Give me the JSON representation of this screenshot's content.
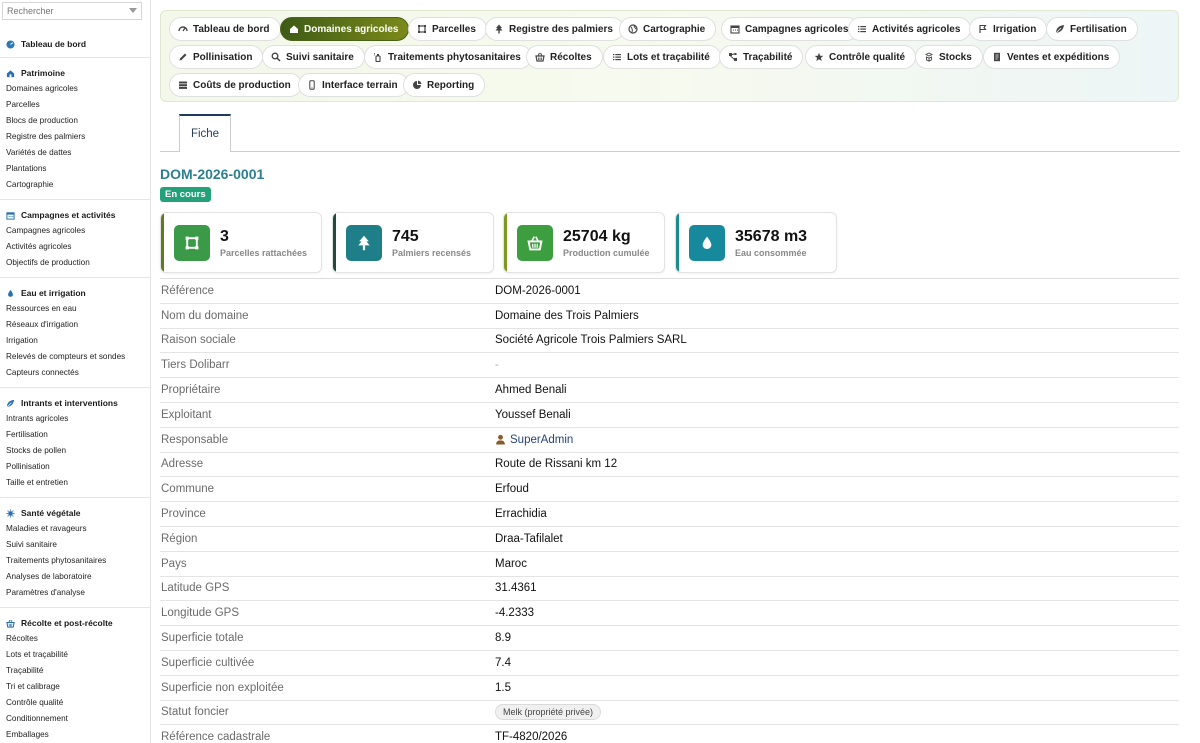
{
  "sidebar": {
    "search_placeholder": "Rechercher",
    "dashboard": "Tableau de bord",
    "sections": [
      {
        "title": "Patrimoine",
        "items": [
          "Domaines agricoles",
          "Parcelles",
          "Blocs de production",
          "Registre des palmiers",
          "Variétés de dattes",
          "Plantations",
          "Cartographie"
        ]
      },
      {
        "title": "Campagnes et activités",
        "items": [
          "Campagnes agricoles",
          "Activités agricoles",
          "Objectifs de production"
        ]
      },
      {
        "title": "Eau et irrigation",
        "items": [
          "Ressources en eau",
          "Réseaux d'irrigation",
          "Irrigation",
          "Relevés de compteurs et sondes",
          "Capteurs connectés"
        ]
      },
      {
        "title": "Intrants et interventions",
        "items": [
          "Intrants agricoles",
          "Fertilisation",
          "Stocks de pollen",
          "Pollinisation",
          "Taille et entretien"
        ]
      },
      {
        "title": "Santé végétale",
        "items": [
          "Maladies et ravageurs",
          "Suivi sanitaire",
          "Traitements phytosanitaires",
          "Analyses de laboratoire",
          "Paramètres d'analyse"
        ]
      },
      {
        "title": "Récolte et post-récolte",
        "items": [
          "Récoltes",
          "Lots et traçabilité",
          "Traçabilité",
          "Tri et calibrage",
          "Contrôle qualité",
          "Conditionnement",
          "Emballages"
        ]
      }
    ]
  },
  "tabs": [
    {
      "label": "Tableau de bord",
      "icon": "gauge-icon",
      "active": false
    },
    {
      "label": "Domaines agricoles",
      "icon": "farm-icon",
      "active": true
    },
    {
      "label": "Parcelles",
      "icon": "parcel-icon",
      "active": false
    },
    {
      "label": "Registre des palmiers",
      "icon": "tree-icon",
      "active": false
    },
    {
      "label": "Cartographie",
      "icon": "globe-icon",
      "active": false
    },
    {
      "label": "Campagnes agricoles",
      "icon": "calendar-icon",
      "active": false
    },
    {
      "label": "Activités agricoles",
      "icon": "list-icon",
      "active": false
    },
    {
      "label": "Irrigation",
      "icon": "water-icon",
      "active": false
    },
    {
      "label": "Fertilisation",
      "icon": "leaf-icon",
      "active": false
    },
    {
      "label": "Pollinisation",
      "icon": "pencil-icon",
      "active": false
    },
    {
      "label": "Suivi sanitaire",
      "icon": "search-icon",
      "active": false
    },
    {
      "label": "Traitements phytosanitaires",
      "icon": "spray-icon",
      "active": false
    },
    {
      "label": "Récoltes",
      "icon": "basket-icon",
      "active": false
    },
    {
      "label": "Lots et traçabilité",
      "icon": "list-icon",
      "active": false
    },
    {
      "label": "Traçabilité",
      "icon": "network-icon",
      "active": false
    },
    {
      "label": "Contrôle qualité",
      "icon": "star-icon",
      "active": false
    },
    {
      "label": "Stocks",
      "icon": "cubes-icon",
      "active": false
    },
    {
      "label": "Ventes et expéditions",
      "icon": "invoice-icon",
      "active": false
    },
    {
      "label": "Coûts de production",
      "icon": "money-icon",
      "active": false
    },
    {
      "label": "Interface terrain",
      "icon": "mobile-icon",
      "active": false
    },
    {
      "label": "Reporting",
      "icon": "pie-icon",
      "active": false
    }
  ],
  "subtab": "Fiche",
  "record": {
    "ref": "DOM-2026-0001",
    "status": "En cours"
  },
  "kpis": [
    {
      "value": "3",
      "label": "Parcelles rattachées",
      "icon": "parcel-icon",
      "color": "#3a9a48",
      "bar": "#5c7d1e"
    },
    {
      "value": "745",
      "label": "Palmiers recensés",
      "icon": "tree-icon",
      "color": "#1f7f88",
      "bar": "#1f4c3c"
    },
    {
      "value": "25704 kg",
      "label": "Production cumulée",
      "icon": "basket-icon",
      "color": "#3c9e3f",
      "bar": "#7c9a1e"
    },
    {
      "value": "35678 m3",
      "label": "Eau consommée",
      "icon": "drop-icon",
      "color": "#168a9c",
      "bar": "#1a8c8c"
    }
  ],
  "fields": [
    {
      "label": "Référence",
      "value": "DOM-2026-0001"
    },
    {
      "label": "Nom du domaine",
      "value": "Domaine des Trois Palmiers"
    },
    {
      "label": "Raison sociale",
      "value": "Société Agricole Trois Palmiers SARL"
    },
    {
      "label": "Tiers Dolibarr",
      "value": "-",
      "muted": true
    },
    {
      "label": "Propriétaire",
      "value": "Ahmed Benali"
    },
    {
      "label": "Exploitant",
      "value": "Youssef Benali"
    },
    {
      "label": "Responsable",
      "value": "SuperAdmin",
      "link": true
    },
    {
      "label": "Adresse",
      "value": "Route de Rissani km 12"
    },
    {
      "label": "Commune",
      "value": "Erfoud"
    },
    {
      "label": "Province",
      "value": "Errachidia"
    },
    {
      "label": "Région",
      "value": "Draa-Tafilalet"
    },
    {
      "label": "Pays",
      "value": "Maroc"
    },
    {
      "label": "Latitude GPS",
      "value": "31.4361"
    },
    {
      "label": "Longitude GPS",
      "value": "-4.2333"
    },
    {
      "label": "Superficie totale",
      "value": "8.9"
    },
    {
      "label": "Superficie cultivée",
      "value": "7.4"
    },
    {
      "label": "Superficie non exploitée",
      "value": "1.5"
    },
    {
      "label": "Statut foncier",
      "value": "Melk (propriété privée)",
      "chip": true
    },
    {
      "label": "Référence cadastrale",
      "value": "TF-4820/2026"
    }
  ]
}
